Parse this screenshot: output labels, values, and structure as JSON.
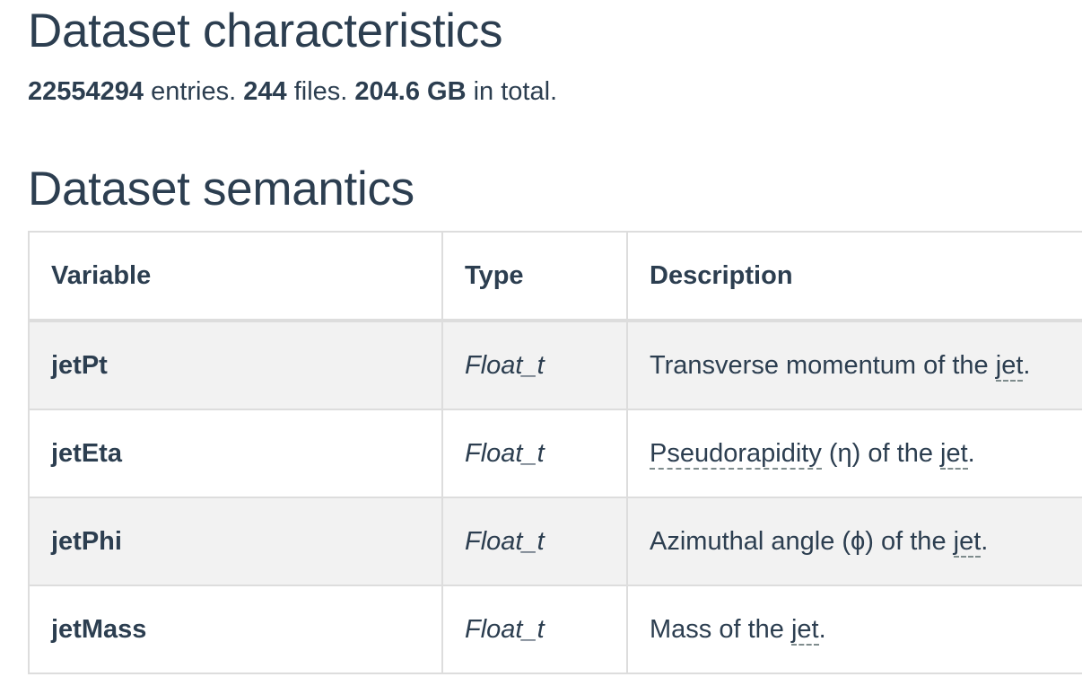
{
  "characteristics": {
    "heading": "Dataset characteristics",
    "entries_count": "22554294",
    "entries_label": " entries. ",
    "files_count": "244",
    "files_label": " files. ",
    "size": "204.6 GB",
    "size_label": " in total."
  },
  "semantics": {
    "heading": "Dataset semantics",
    "columns": [
      "Variable",
      "Type",
      "Description"
    ],
    "rows": [
      {
        "variable": "jetPt",
        "type": "Float_t",
        "desc_pre": "Transverse momentum of the ",
        "desc_abbr": "jet",
        "desc_post": "."
      },
      {
        "variable": "jetEta",
        "type": "Float_t",
        "desc_abbr1": "Pseudorapidity",
        "desc_mid": " (η) of the ",
        "desc_abbr2": "jet",
        "desc_post": "."
      },
      {
        "variable": "jetPhi",
        "type": "Float_t",
        "desc_pre": "Azimuthal angle (ϕ) of the ",
        "desc_abbr": "jet",
        "desc_post": "."
      },
      {
        "variable": "jetMass",
        "type": "Float_t",
        "desc_pre": "Mass of the ",
        "desc_abbr": "jet",
        "desc_post": "."
      }
    ]
  }
}
